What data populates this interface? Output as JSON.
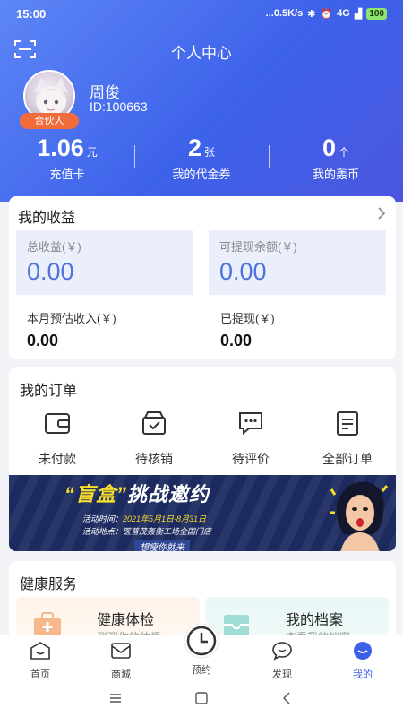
{
  "status_bar": {
    "time": "15:00",
    "network_speed": "...0.5K/s",
    "signal_label": "4G",
    "battery": "100"
  },
  "header": {
    "title": "个人中心",
    "user": {
      "name": "周俊",
      "id": "ID:100663",
      "badge": "合伙人"
    }
  },
  "stats": [
    {
      "value": "1.06",
      "unit": "元",
      "label": "充值卡"
    },
    {
      "value": "2",
      "unit": "张",
      "label": "我的代金券"
    },
    {
      "value": "0",
      "unit": "个",
      "label": "我的轰币"
    }
  ],
  "earnings": {
    "title": "我的收益",
    "total_label": "总收益(￥)",
    "total_value": "0.00",
    "withdrawable_label": "可提现余额(￥)",
    "withdrawable_value": "0.00",
    "month_label": "本月预估收入(￥)",
    "month_value": "0.00",
    "withdrawn_label": "已提现(￥)",
    "withdrawn_value": "0.00"
  },
  "orders": {
    "title": "我的订单",
    "items": [
      {
        "label": "未付款",
        "icon": "wallet-icon"
      },
      {
        "label": "待核销",
        "icon": "box-check-icon"
      },
      {
        "label": "待评价",
        "icon": "comment-icon"
      },
      {
        "label": "全部订单",
        "icon": "order-list-icon"
      }
    ]
  },
  "banner": {
    "title_blind": "“盲盒”",
    "title_rest": "挑战邀约",
    "line1_label": "活动时间：",
    "line1_value": "2021年5月1日-8月31日",
    "line2_label": "活动地点：",
    "line2_value": "医普茂轰衡工场全国门店",
    "slogan": "想瘦你就来"
  },
  "health": {
    "title": "健康服务",
    "items": [
      {
        "title": "健康体检",
        "subtitle": "测测你的体质",
        "icon": "medical-kit-icon"
      },
      {
        "title": "我的档案",
        "subtitle": "查看我的档案",
        "icon": "archive-icon"
      }
    ]
  },
  "tabbar": {
    "items": [
      {
        "label": "首页",
        "icon": "home-icon"
      },
      {
        "label": "商城",
        "icon": "mail-shop-icon"
      },
      {
        "label": "预约",
        "icon": "clock-icon"
      },
      {
        "label": "发现",
        "icon": "chat-bubble-icon"
      },
      {
        "label": "我的",
        "icon": "profile-icon",
        "active": true
      }
    ]
  },
  "colors": {
    "primary": "#3d5ee6",
    "header_gradient_start": "#5d86f6",
    "value_blue": "#4f73de",
    "badge_orange": "#f26b3a"
  }
}
